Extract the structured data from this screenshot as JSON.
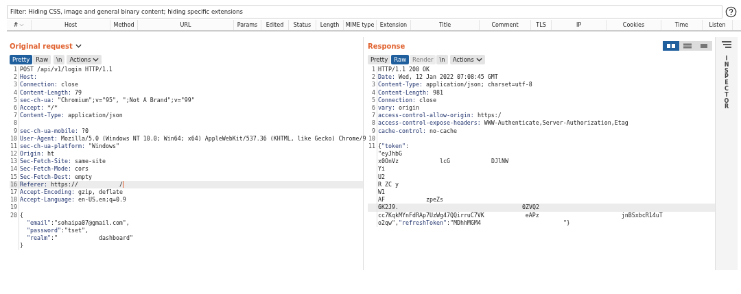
{
  "filter": {
    "text": "Filter: Hiding CSS, image and general binary content;  hiding specific extensions"
  },
  "table": {
    "columns": [
      {
        "label": "#",
        "sortable": true
      },
      {
        "label": "Host"
      },
      {
        "label": "Method"
      },
      {
        "label": "URL"
      },
      {
        "label": "Params"
      },
      {
        "label": "Edited"
      },
      {
        "label": "Status"
      },
      {
        "label": "Length"
      },
      {
        "label": "MIME type"
      },
      {
        "label": "Extension"
      },
      {
        "label": "Title"
      },
      {
        "label": "Comment"
      },
      {
        "label": "TLS"
      },
      {
        "label": "IP"
      },
      {
        "label": "Cookies"
      },
      {
        "label": "Time"
      },
      {
        "label": "Listen"
      }
    ]
  },
  "request": {
    "title": "Original request",
    "tabs": [
      {
        "label": "Pretty",
        "selected": true,
        "disabled": false
      },
      {
        "label": "Raw",
        "selected": false,
        "disabled": false
      },
      {
        "label": "\\n",
        "selected": false,
        "disabled": false
      }
    ],
    "actions": "Actions",
    "lines": [
      {
        "number": "1",
        "highlighted": false,
        "segments": [
          {
            "kind": "text",
            "text": "POST /api/v1/login HTTP/1.1"
          }
        ]
      },
      {
        "number": "2",
        "highlighted": false,
        "segments": [
          {
            "kind": "key",
            "text": "Host:"
          }
        ]
      },
      {
        "number": "3",
        "highlighted": false,
        "segments": [
          {
            "kind": "key",
            "text": "Connection:"
          },
          {
            "kind": "text",
            "text": "close"
          }
        ]
      },
      {
        "number": "4",
        "highlighted": false,
        "segments": [
          {
            "kind": "key",
            "text": "Content-Length:"
          },
          {
            "kind": "text",
            "text": "79"
          }
        ]
      },
      {
        "number": "5",
        "highlighted": false,
        "segments": [
          {
            "kind": "key",
            "text": "sec-ch-ua:"
          },
          {
            "kind": "text",
            "text": "\"Chromium\";v=\"95\", \";Not A Brand\";v=\"99\""
          }
        ]
      },
      {
        "number": "6",
        "highlighted": false,
        "segments": [
          {
            "kind": "key",
            "text": "Accept:"
          },
          {
            "kind": "text",
            "text": "*/*"
          }
        ]
      },
      {
        "number": "7",
        "highlighted": false,
        "segments": [
          {
            "kind": "key",
            "text": "Content-Type:"
          },
          {
            "kind": "text",
            "text": "application/json"
          }
        ]
      },
      {
        "number": "8",
        "highlighted": false
      },
      {
        "number": "9",
        "highlighted": false,
        "segments": [
          {
            "kind": "key",
            "text": "sec-ch-ua-mobile:"
          },
          {
            "kind": "text",
            "text": "?0"
          }
        ]
      },
      {
        "number": "10",
        "highlighted": false,
        "segments": [
          {
            "kind": "key",
            "text": "User-Agent:"
          },
          {
            "kind": "text",
            "text": "Mozilla/5.0 (Windows NT 10.0; Win64; x64) AppleWebKit/537.36 (KHTML, like Gecko) Chrome/9"
          }
        ]
      },
      {
        "number": "11",
        "highlighted": false,
        "segments": [
          {
            "kind": "key",
            "text": "sec-ch-ua-platform:"
          },
          {
            "kind": "text",
            "text": "\"Windows\""
          }
        ]
      },
      {
        "number": "12",
        "highlighted": false,
        "segments": [
          {
            "kind": "key",
            "text": "Origin:"
          },
          {
            "kind": "text",
            "text": "ht"
          }
        ]
      },
      {
        "number": "13",
        "highlighted": false,
        "segments": [
          {
            "kind": "key",
            "text": "Sec-Fetch-Site:"
          },
          {
            "kind": "text",
            "text": "same-site"
          }
        ]
      },
      {
        "number": "14",
        "highlighted": false,
        "segments": [
          {
            "kind": "key",
            "text": "Sec-Fetch-Mode:"
          },
          {
            "kind": "text",
            "text": "cors"
          }
        ]
      },
      {
        "number": "15",
        "highlighted": false,
        "segments": [
          {
            "kind": "key",
            "text": "Sec-Fetch-Dest:"
          },
          {
            "kind": "text",
            "text": "empty"
          }
        ]
      },
      {
        "number": "16",
        "highlighted": true,
        "segments": [
          {
            "kind": "key",
            "text": "Referer:"
          },
          {
            "kind": "text",
            "text": "https://"
          },
          {
            "kind": "gap"
          },
          {
            "kind": "text",
            "text": "/"
          }
        ]
      },
      {
        "number": "17",
        "highlighted": false,
        "segments": [
          {
            "kind": "key",
            "text": "Accept-Encoding:"
          },
          {
            "kind": "text",
            "text": "gzip, deflate"
          }
        ]
      },
      {
        "number": "18",
        "highlighted": false,
        "segments": [
          {
            "kind": "key",
            "text": "Accept-Language:"
          },
          {
            "kind": "text",
            "text": "en-US,en;q=0.9"
          }
        ]
      },
      {
        "number": "19",
        "highlighted": false
      },
      {
        "number": "20",
        "highlighted": false,
        "segments": [
          {
            "kind": "text",
            "text": "{"
          }
        ]
      },
      {
        "highlighted": false,
        "segments": [
          {
            "kind": "key",
            "text": "  \"email\""
          },
          {
            "kind": "text",
            "text": ":\"sohaipa07@gmail.com\","
          }
        ]
      },
      {
        "highlighted": false,
        "segments": [
          {
            "kind": "key",
            "text": "  \"password\""
          },
          {
            "kind": "text",
            "text": ":\"tset\","
          }
        ]
      },
      {
        "highlighted": false,
        "segments": [
          {
            "kind": "key",
            "text": "  \"realm\""
          },
          {
            "kind": "text",
            "text": ":\""
          },
          {
            "kind": "gap"
          },
          {
            "kind": "text",
            "text": "dashboard\""
          }
        ]
      },
      {
        "highlighted": false,
        "segments": [
          {
            "kind": "text",
            "text": "}"
          }
        ]
      }
    ]
  },
  "response": {
    "title": "Response",
    "tabs": [
      {
        "label": "Pretty",
        "selected": false,
        "disabled": false
      },
      {
        "label": "Raw",
        "selected": true,
        "disabled": false
      },
      {
        "label": "Render",
        "selected": false,
        "disabled": true
      },
      {
        "label": "\\n",
        "selected": false,
        "disabled": false
      }
    ],
    "actions": "Actions",
    "layouts": [
      {
        "selected": true
      },
      {
        "selected": false
      },
      {
        "selected": false
      }
    ],
    "lines": [
      {
        "number": "1",
        "highlighted": false,
        "segments": [
          {
            "kind": "text",
            "text": "HTTP/1.1 200 OK"
          }
        ]
      },
      {
        "number": "2",
        "highlighted": false,
        "segments": [
          {
            "kind": "key",
            "text": "Date:"
          },
          {
            "kind": "text",
            "text": "Wed, 12 Jan 2022 07:08:45 GMT"
          }
        ]
      },
      {
        "number": "3",
        "highlighted": false,
        "segments": [
          {
            "kind": "key",
            "text": "Content-Type:"
          },
          {
            "kind": "text",
            "text": "application/json; charset=utf-8"
          }
        ]
      },
      {
        "number": "4",
        "highlighted": false,
        "segments": [
          {
            "kind": "key",
            "text": "Content-Length:"
          },
          {
            "kind": "text",
            "text": "981"
          }
        ]
      },
      {
        "number": "5",
        "highlighted": false,
        "segments": [
          {
            "kind": "key",
            "text": "Connection:"
          },
          {
            "kind": "text",
            "text": "close"
          }
        ]
      },
      {
        "number": "6",
        "highlighted": false,
        "segments": [
          {
            "kind": "key",
            "text": "vary:"
          },
          {
            "kind": "text",
            "text": "origin"
          }
        ]
      },
      {
        "number": "7",
        "highlighted": false,
        "segments": [
          {
            "kind": "key",
            "text": "access-control-allow-origin:"
          },
          {
            "kind": "text",
            "text": "https:/"
          }
        ]
      },
      {
        "number": "8",
        "highlighted": false,
        "segments": [
          {
            "kind": "key",
            "text": "access-control-expose-headers:"
          },
          {
            "kind": "text",
            "text": "WWW-Authenticate,Server-Authorization,Etag"
          }
        ]
      },
      {
        "number": "9",
        "highlighted": false,
        "segments": [
          {
            "kind": "key",
            "text": "cache-control:"
          },
          {
            "kind": "text",
            "text": "no-cache"
          }
        ]
      },
      {
        "number": "10",
        "highlighted": false
      },
      {
        "number": "11",
        "highlighted": false,
        "segments": [
          {
            "kind": "text",
            "text": "{"
          },
          {
            "kind": "key",
            "text": "\"token\""
          },
          {
            "kind": "text",
            "text": ":"
          }
        ]
      },
      {
        "highlighted": false,
        "segments": [
          {
            "kind": "text",
            "text": "\"eyJhbG"
          }
        ]
      },
      {
        "highlighted": false,
        "segments": [
          {
            "kind": "text",
            "text": "x0OnVz"
          },
          {
            "kind": "gap"
          },
          {
            "kind": "text",
            "text": "lcG"
          },
          {
            "kind": "gap"
          },
          {
            "kind": "text",
            "text": "DJlNW"
          }
        ]
      },
      {
        "highlighted": false,
        "segments": [
          {
            "kind": "text",
            "text": "Yi"
          }
        ]
      },
      {
        "highlighted": false,
        "segments": [
          {
            "kind": "text",
            "text": "U2"
          }
        ]
      },
      {
        "highlighted": false,
        "segments": [
          {
            "kind": "text",
            "text": "R ZC y"
          }
        ]
      },
      {
        "highlighted": false,
        "segments": [
          {
            "kind": "text",
            "text": "W1"
          }
        ]
      },
      {
        "highlighted": false,
        "segments": [
          {
            "kind": "text",
            "text": "AF"
          },
          {
            "kind": "gap"
          },
          {
            "kind": "text",
            "text": "zpeZs"
          }
        ]
      },
      {
        "highlighted": true,
        "segments": [
          {
            "kind": "text",
            "text": "6K2J9."
          },
          {
            "kind": "gap"
          },
          {
            "kind": "gap"
          },
          {
            "kind": "gap"
          },
          {
            "kind": "text",
            "text": "0ZVQ2"
          }
        ]
      },
      {
        "highlighted": false,
        "segments": [
          {
            "kind": "text",
            "text": "cc7KqkMYnFdRAp7UzWg47QQirruC7VK"
          },
          {
            "kind": "gap"
          },
          {
            "kind": "text",
            "text": "eAPz"
          },
          {
            "kind": "gap"
          },
          {
            "kind": "gap"
          },
          {
            "kind": "text",
            "text": "jnBSxbcR14uT"
          }
        ]
      },
      {
        "highlighted": false,
        "segments": [
          {
            "kind": "text",
            "text": "o2qw\","
          },
          {
            "kind": "key",
            "text": "\"refreshToken\""
          },
          {
            "kind": "text",
            "text": ":\"MDhhMGM4"
          },
          {
            "kind": "gap"
          },
          {
            "kind": "gap"
          },
          {
            "kind": "text",
            "text": "\"}"
          }
        ]
      }
    ]
  },
  "inspector": {
    "label": "INSPECTOR"
  }
}
